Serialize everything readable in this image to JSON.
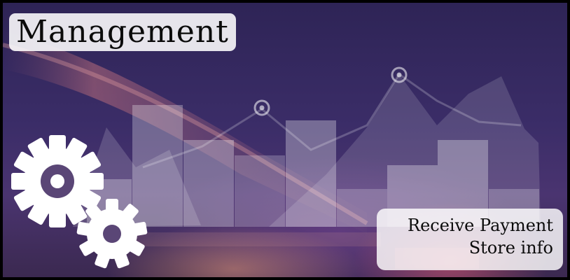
{
  "header": {
    "title": "Management"
  },
  "info_box": {
    "line1": "Receive Payment",
    "line2": "Store info"
  },
  "icons": [
    "gear-icon",
    "gear-icon",
    "location-pin-icon",
    "location-pin-icon"
  ],
  "colors": {
    "background": "#3b2d68",
    "badge": "#ffffff",
    "text": "#0b0b0b"
  }
}
